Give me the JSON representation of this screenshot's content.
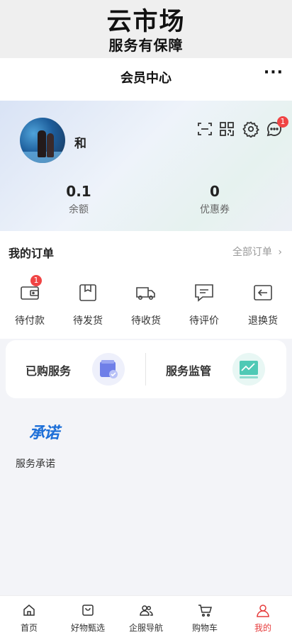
{
  "banner": {
    "title": "云市场",
    "subtitle": "服务有保障"
  },
  "navbar": {
    "title": "会员中心",
    "more": "···"
  },
  "profile": {
    "username": "和",
    "message_badge": "1",
    "icons": [
      "scan-icon",
      "qrcode-icon",
      "settings-icon",
      "message-icon"
    ],
    "stats": [
      {
        "value": "0.1",
        "label": "余额"
      },
      {
        "value": "0",
        "label": "优惠券"
      }
    ]
  },
  "orders": {
    "title": "我的订单",
    "all_label": "全部订单",
    "items": [
      {
        "label": "待付款",
        "icon": "wallet-icon",
        "badge": "1"
      },
      {
        "label": "待发货",
        "icon": "package-icon"
      },
      {
        "label": "待收货",
        "icon": "truck-icon"
      },
      {
        "label": "待评价",
        "icon": "comment-icon"
      },
      {
        "label": "退换货",
        "icon": "return-icon"
      }
    ]
  },
  "services": {
    "purchased": "已购服务",
    "supervision": "服务监管"
  },
  "promise": {
    "logo_text": "承诺",
    "label": "服务承诺"
  },
  "tabbar": {
    "items": [
      {
        "label": "首页",
        "icon": "home-icon"
      },
      {
        "label": "好物甄选",
        "icon": "bag-icon"
      },
      {
        "label": "企服导航",
        "icon": "people-icon"
      },
      {
        "label": "购物车",
        "icon": "cart-icon"
      },
      {
        "label": "我的",
        "icon": "user-icon",
        "active": true
      }
    ],
    "active_color": "#e63b3b"
  }
}
